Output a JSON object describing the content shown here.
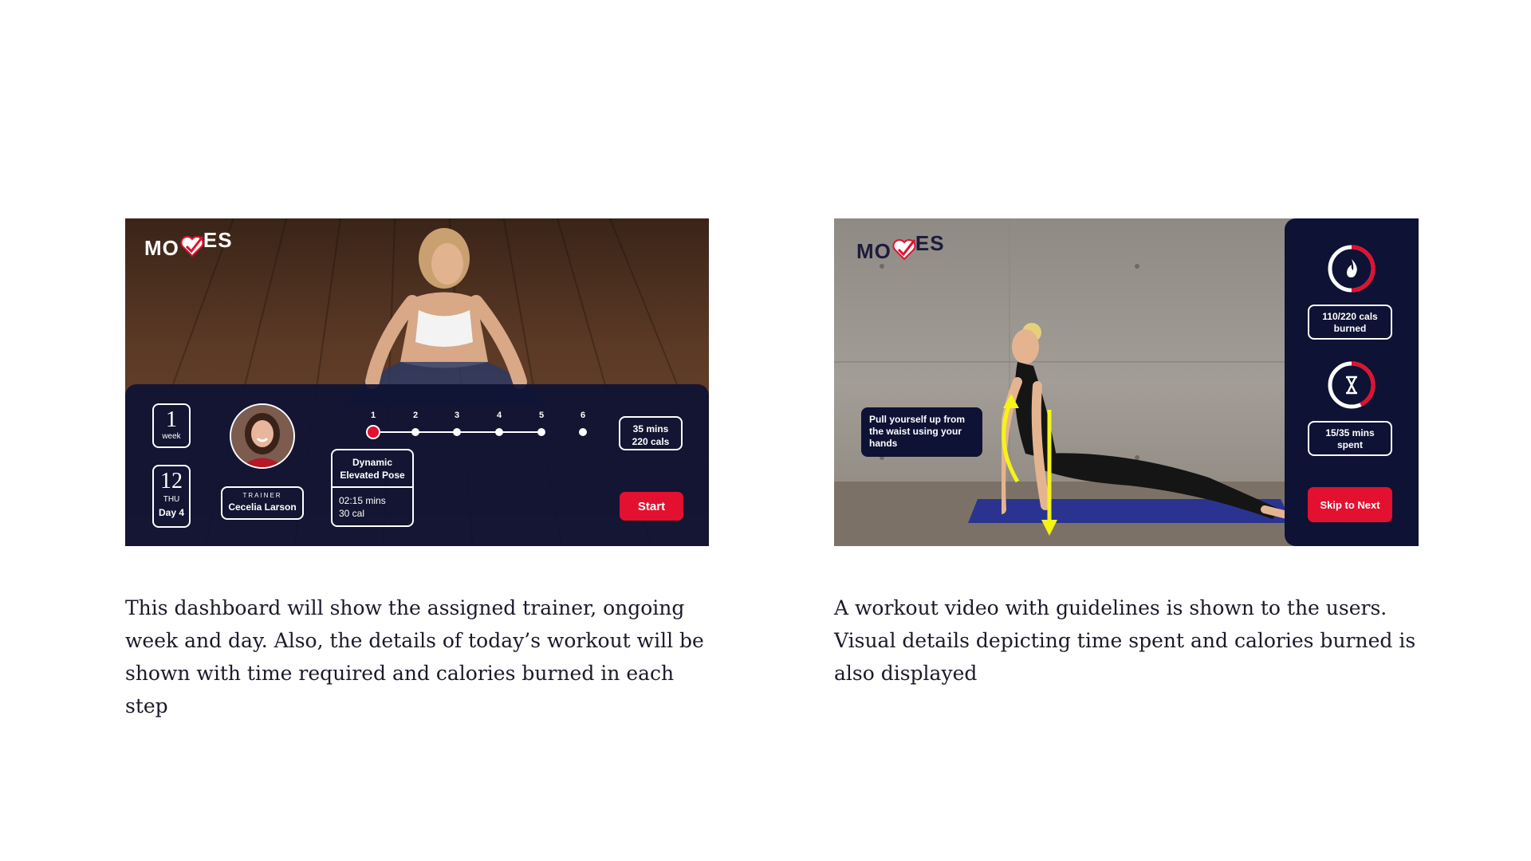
{
  "logo_text_left": "MO",
  "logo_text_right": "ES",
  "dashboard": {
    "week": {
      "number": "1",
      "label": "week"
    },
    "day": {
      "date": "12",
      "weekday": "THU",
      "day_label": "Day 4"
    },
    "trainer": {
      "caption": "TRAINER",
      "name": "Cecelia Larson"
    },
    "steps": [
      "1",
      "2",
      "3",
      "4",
      "5",
      "6"
    ],
    "active_step": 1,
    "current_pose": {
      "name_line1": "Dynamic",
      "name_line2": "Elevated Pose",
      "duration": "02:15 mins",
      "calories": "30 cal"
    },
    "total": {
      "time": "35 mins",
      "calories": "220 cals"
    },
    "start_label": "Start"
  },
  "workout": {
    "tip": "Pull yourself up from the waist using your hands",
    "calories": {
      "line1": "110/220 cals",
      "line2": "burned",
      "progress": 0.5
    },
    "time": {
      "line1": "15/35 mins",
      "line2": "spent",
      "progress": 0.43
    },
    "skip_label": "Skip to Next"
  },
  "captions": {
    "left": "This dashboard will show the assigned trainer, ongoing week and day. Also, the details of today’s workout will be shown with time required and calories burned in each step",
    "right": "A workout video with guidelines is shown to the users. Visual details depicting time spent and calories burned is also displayed"
  },
  "colors": {
    "accent": "#e3102f",
    "navy": "#0e1234",
    "arrow": "#f4f416"
  }
}
